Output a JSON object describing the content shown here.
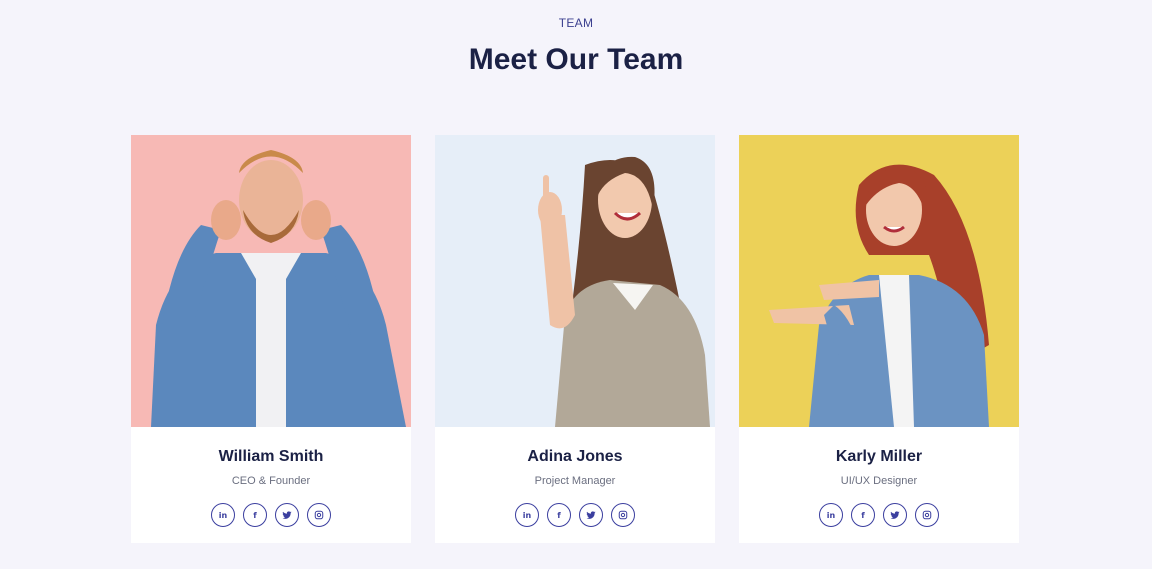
{
  "section": {
    "eyebrow": "TEAM",
    "title": "Meet Our Team"
  },
  "members": [
    {
      "name": "William Smith",
      "role": "CEO & Founder",
      "photo_bg": "#f7b9b5",
      "socials": [
        "linkedin-icon",
        "facebook-icon",
        "twitter-icon",
        "instagram-icon"
      ]
    },
    {
      "name": "Adina Jones",
      "role": "Project Manager",
      "photo_bg": "#e6eef8",
      "socials": [
        "linkedin-icon",
        "facebook-icon",
        "twitter-icon",
        "instagram-icon"
      ]
    },
    {
      "name": "Karly Miller",
      "role": "UI/UX Designer",
      "photo_bg": "#ecd158",
      "socials": [
        "linkedin-icon",
        "facebook-icon",
        "twitter-icon",
        "instagram-icon"
      ]
    }
  ],
  "social_glyphs": {
    "linkedin": "in",
    "facebook": "f",
    "twitter": "✓",
    "instagram": "◎"
  },
  "colors": {
    "page_bg": "#f5f4fb",
    "heading": "#1b2145",
    "accent": "#3b3f9f"
  }
}
